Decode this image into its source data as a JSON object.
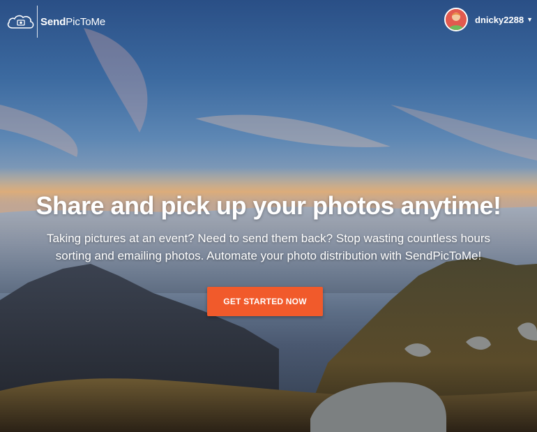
{
  "header": {
    "brand_bold": "Send",
    "brand_rest": "PicToMe",
    "username": "dnicky2288"
  },
  "hero": {
    "headline": "Share and pick up your photos anytime!",
    "subtext": "Taking pictures at an event? Need to send them back? Stop wasting countless hours sorting and emailing photos. Automate your photo distribution with SendPicToMe!",
    "cta_label": "GET STARTED NOW"
  },
  "icons": {
    "logo": "cloud-photo-icon",
    "avatar": "user-avatar",
    "dropdown": "caret-down-icon"
  },
  "colors": {
    "accent": "#f15a2b",
    "text": "#ffffff"
  }
}
